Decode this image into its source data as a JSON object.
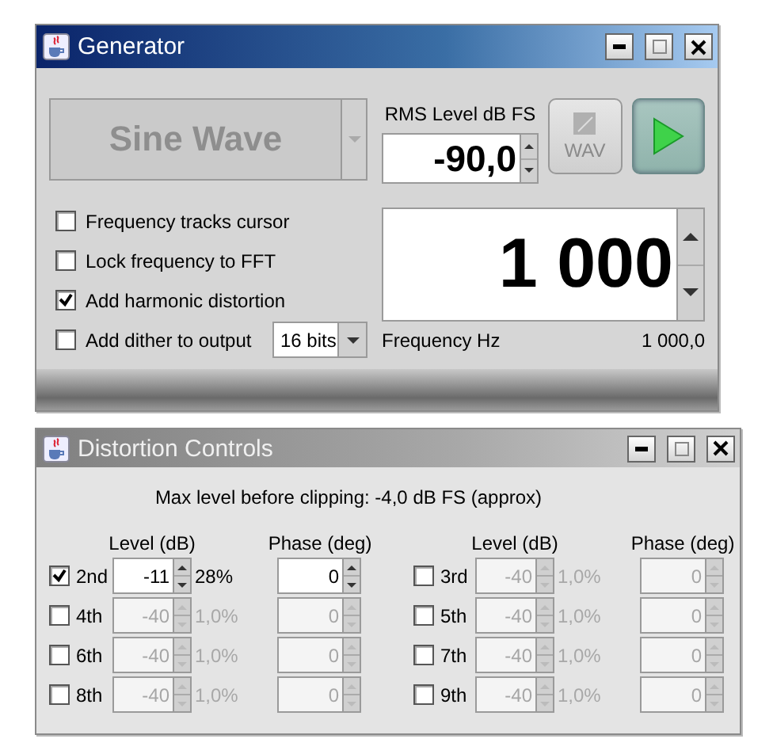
{
  "generator": {
    "title": "Generator",
    "active": true,
    "waveform": {
      "value": "Sine Wave",
      "disabled": true
    },
    "rms_level": {
      "label": "RMS Level dB FS",
      "value": "-90,0"
    },
    "wav_button": {
      "label": "WAV",
      "disabled": true
    },
    "play_button": {
      "on": true
    },
    "options": [
      {
        "label": "Frequency tracks cursor",
        "checked": false
      },
      {
        "label": "Lock frequency to FFT",
        "checked": false
      },
      {
        "label": "Add harmonic distortion",
        "checked": true
      },
      {
        "label": "Add dither to output",
        "checked": false
      }
    ],
    "dither_bits": "16 bits",
    "frequency": {
      "value": "1 000",
      "label": "Frequency Hz",
      "reading": "1 000,0"
    }
  },
  "distortion": {
    "title": "Distortion Controls",
    "active": false,
    "note": "Max level before clipping: -4,0 dB FS (approx)",
    "headers": [
      "Level (dB)",
      "Phase (deg)",
      "Level (dB)",
      "Phase (deg)"
    ],
    "harmonics": [
      {
        "label": "2nd",
        "checked": true,
        "level": "-11",
        "percent": "28%",
        "phase": "0"
      },
      {
        "label": "3rd",
        "checked": false,
        "level": "-40",
        "percent": "1,0%",
        "phase": "0"
      },
      {
        "label": "4th",
        "checked": false,
        "level": "-40",
        "percent": "1,0%",
        "phase": "0"
      },
      {
        "label": "5th",
        "checked": false,
        "level": "-40",
        "percent": "1,0%",
        "phase": "0"
      },
      {
        "label": "6th",
        "checked": false,
        "level": "-40",
        "percent": "1,0%",
        "phase": "0"
      },
      {
        "label": "7th",
        "checked": false,
        "level": "-40",
        "percent": "1,0%",
        "phase": "0"
      },
      {
        "label": "8th",
        "checked": false,
        "level": "-40",
        "percent": "1,0%",
        "phase": "0"
      },
      {
        "label": "9th",
        "checked": false,
        "level": "-40",
        "percent": "1,0%",
        "phase": "0"
      }
    ]
  }
}
